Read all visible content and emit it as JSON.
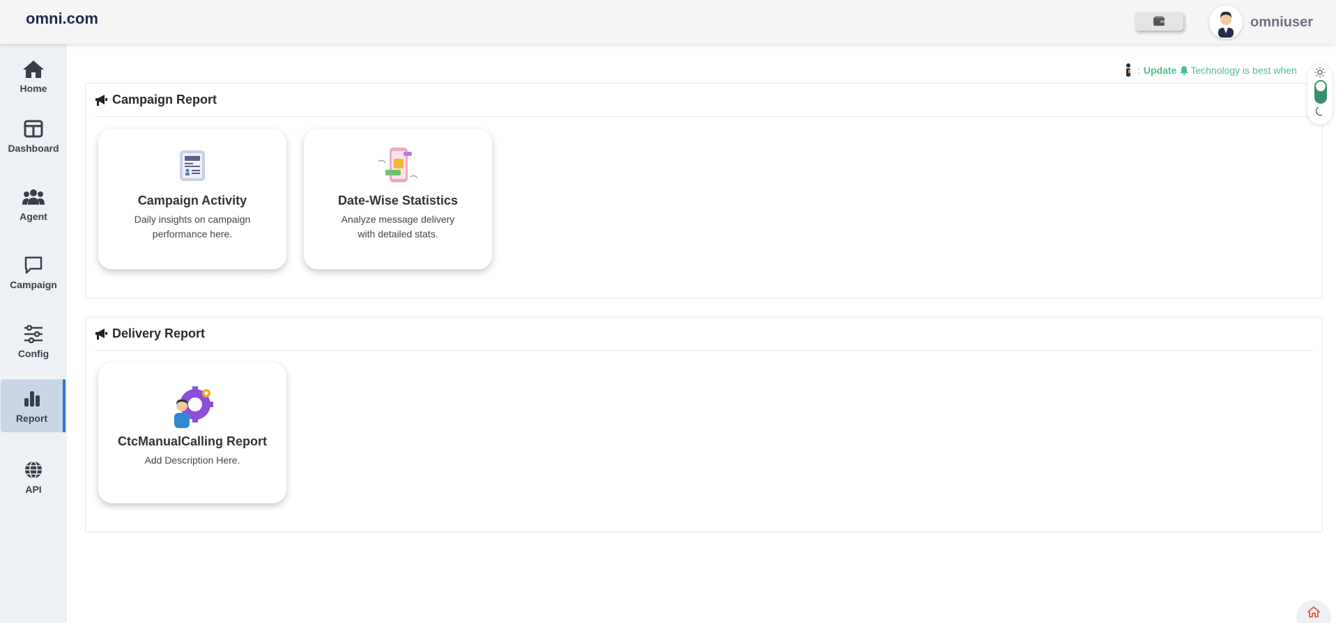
{
  "header": {
    "brand": "omni.com",
    "username": "omniuser"
  },
  "sidebar": {
    "items": [
      {
        "label": "Home",
        "icon": "home-icon"
      },
      {
        "label": "Dashboard",
        "icon": "dashboard-icon"
      },
      {
        "label": "Agent",
        "icon": "users-icon"
      },
      {
        "label": "Campaign",
        "icon": "chat-icon"
      },
      {
        "label": "Config",
        "icon": "sliders-icon"
      },
      {
        "label": "Report",
        "icon": "bar-chart-icon",
        "active": true
      },
      {
        "label": "API",
        "icon": "globe-icon"
      }
    ]
  },
  "ticker": {
    "prefix": ":",
    "update": "Update",
    "message": "Technology is best when"
  },
  "sections": [
    {
      "title": "Campaign Report",
      "cards": [
        {
          "title": "Campaign Activity",
          "description": "Daily insights on campaign performance here."
        },
        {
          "title": "Date-Wise Statistics",
          "description": "Analyze message delivery with detailed stats."
        }
      ]
    },
    {
      "title": "Delivery Report",
      "cards": [
        {
          "title": "CtcManualCalling Report",
          "description": "Add Description Here."
        }
      ]
    }
  ],
  "colors": {
    "accent": "#2b78d0",
    "ticker": "#46c28a",
    "toggle": "#3b8e6c",
    "sidebar_bg": "#edf0f4",
    "active_bg": "#c8d6e6"
  }
}
